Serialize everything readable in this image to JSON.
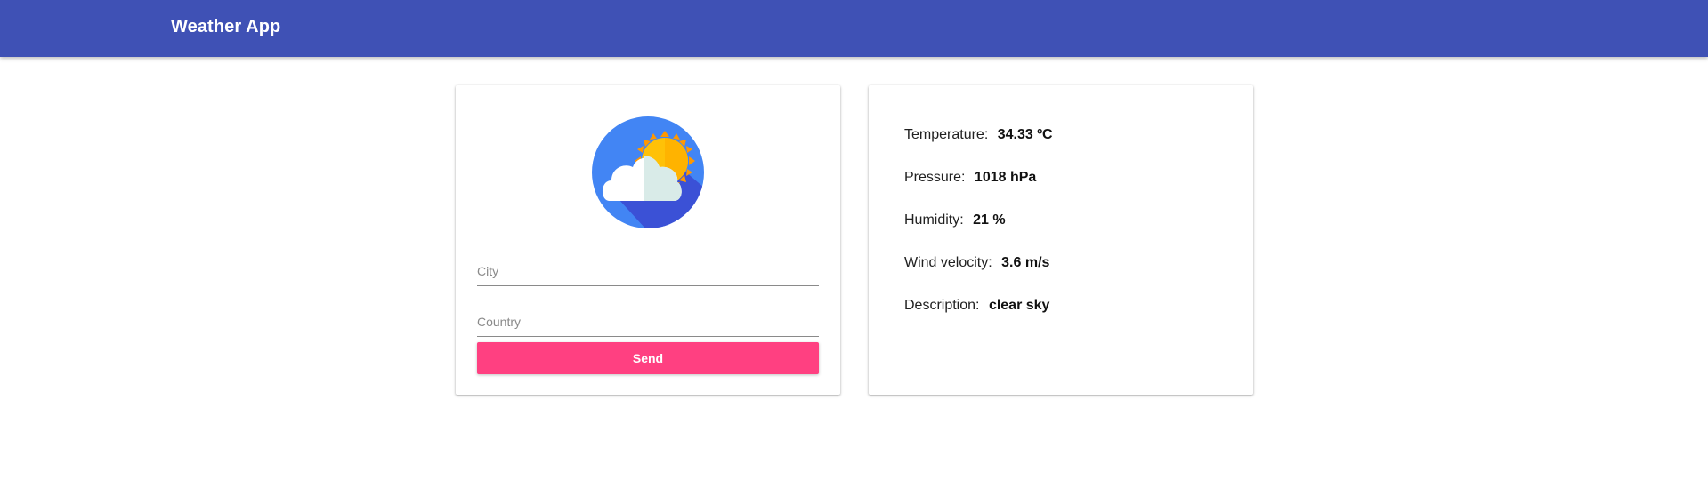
{
  "app_bar": {
    "title": "Weather App",
    "color": "#3f51b5"
  },
  "form": {
    "logo_icon": "partly-cloudy-weather-icon",
    "city": {
      "placeholder": "City",
      "value": ""
    },
    "country": {
      "placeholder": "Country",
      "value": ""
    },
    "send_label": "Send",
    "send_color": "#ff4081"
  },
  "weather": {
    "temperature": {
      "label": "Temperature:",
      "value": "34.33 ºC"
    },
    "pressure": {
      "label": "Pressure:",
      "value": "1018 hPa"
    },
    "humidity": {
      "label": "Humidity:",
      "value": "21 %"
    },
    "wind": {
      "label": "Wind velocity:",
      "value": "3.6 m/s"
    },
    "description": {
      "label": "Description:",
      "value": "clear sky"
    }
  }
}
